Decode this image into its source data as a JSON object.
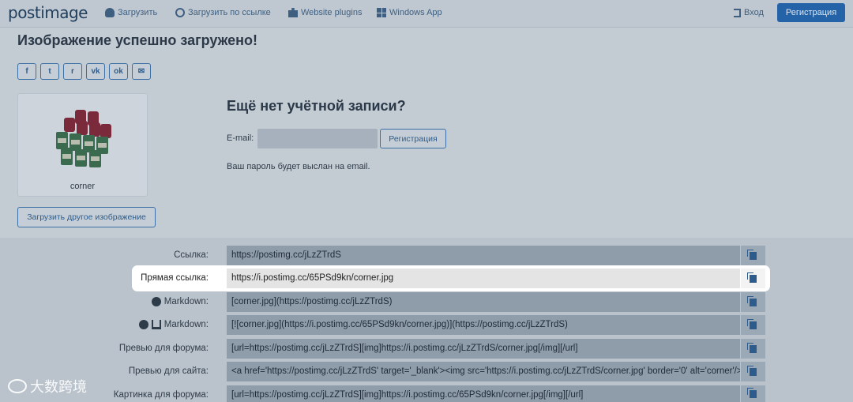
{
  "nav": {
    "logo": "postimage",
    "items": [
      {
        "label": "Загрузить",
        "icon": "cloud-upload-icon"
      },
      {
        "label": "Загрузить по ссылке",
        "icon": "globe-icon"
      },
      {
        "label": "Website plugins",
        "icon": "puzzle-icon"
      },
      {
        "label": "Windows App",
        "icon": "windows-icon"
      }
    ],
    "login": "Вход",
    "register": "Регистрация"
  },
  "page_title": "Изображение успешно загружено!",
  "share": [
    "f",
    "t",
    "r",
    "vk",
    "ok",
    "✉"
  ],
  "thumbnail": {
    "caption": "corner"
  },
  "upload_other": "Загрузить другое изображение",
  "account": {
    "title": "Ещё нет учётной записи?",
    "email_label": "E-mail:",
    "email_value": "",
    "register_button": "Регистрация",
    "password_note": "Ваш пароль будет выслан на email."
  },
  "links": [
    {
      "label": "Ссылка:",
      "value": "https://postimg.cc/jLzZTrdS"
    },
    {
      "label": "Прямая ссылка:",
      "value": "https://i.postimg.cc/65PSd9kn/corner.jpg"
    },
    {
      "label": "Markdown:",
      "value": "[corner.jpg](https://postimg.cc/jLzZTrdS)"
    },
    {
      "label": "Markdown:",
      "value": "[![corner.jpg](https://i.postimg.cc/65PSd9kn/corner.jpg)](https://postimg.cc/jLzZTrdS)"
    },
    {
      "label": "Превью для форума:",
      "value": "[url=https://postimg.cc/jLzZTrdS][img]https://i.postimg.cc/jLzZTrdS/corner.jpg[/img][/url]"
    },
    {
      "label": "Превью для сайта:",
      "value": "<a href='https://postimg.cc/jLzZTrdS' target='_blank'><img src='https://i.postimg.cc/jLzZTrdS/corner.jpg' border='0' alt='corner'/></a>"
    },
    {
      "label": "Картинка для форума:",
      "value": "[url=https://postimg.cc/jLzZTrdS][img]https://i.postimg.cc/65PSd9kn/corner.jpg[/img][/url]"
    }
  ],
  "watermark": "大数跨境",
  "colors": {
    "brand": "#2563a8",
    "highlight": "#ffffff"
  }
}
